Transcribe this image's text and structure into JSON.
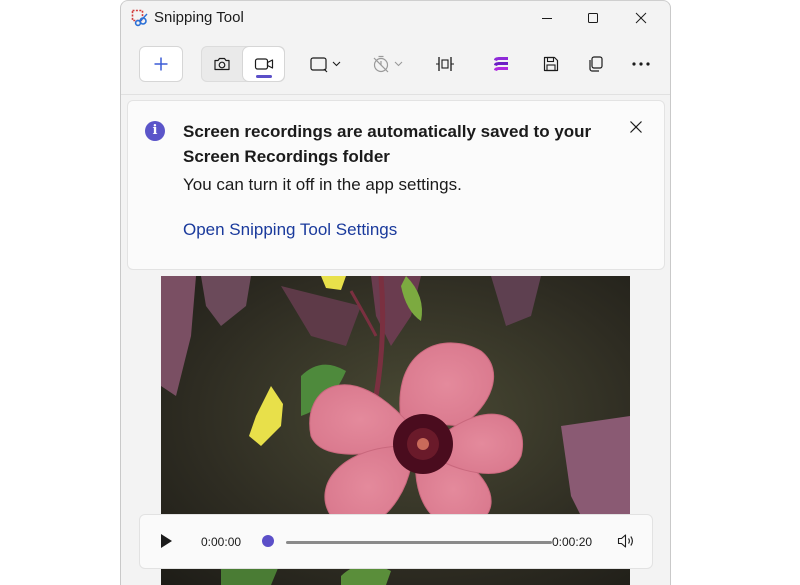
{
  "window": {
    "title": "Snipping Tool"
  },
  "toolbar": {
    "new_icon": "plus-icon",
    "modes": [
      "camera-icon",
      "video-camera-icon"
    ],
    "selected_mode": "video",
    "tools": [
      "rectangle-mode-icon",
      "timer-off-icon",
      "trim-icon",
      "clipchamp-icon",
      "save-icon",
      "copy-icon",
      "more-icon"
    ]
  },
  "notification": {
    "title": "Screen recordings are automatically saved to your Screen Recordings folder",
    "body": "You can turn it off in the app settings.",
    "link": "Open Snipping Tool Settings"
  },
  "player": {
    "current_time": "0:00:00",
    "total_time": "0:00:20",
    "progress": 0.0
  },
  "colors": {
    "accent": "#5b4fc8",
    "link": "#1a3a9c",
    "info": "#5b55c9"
  }
}
